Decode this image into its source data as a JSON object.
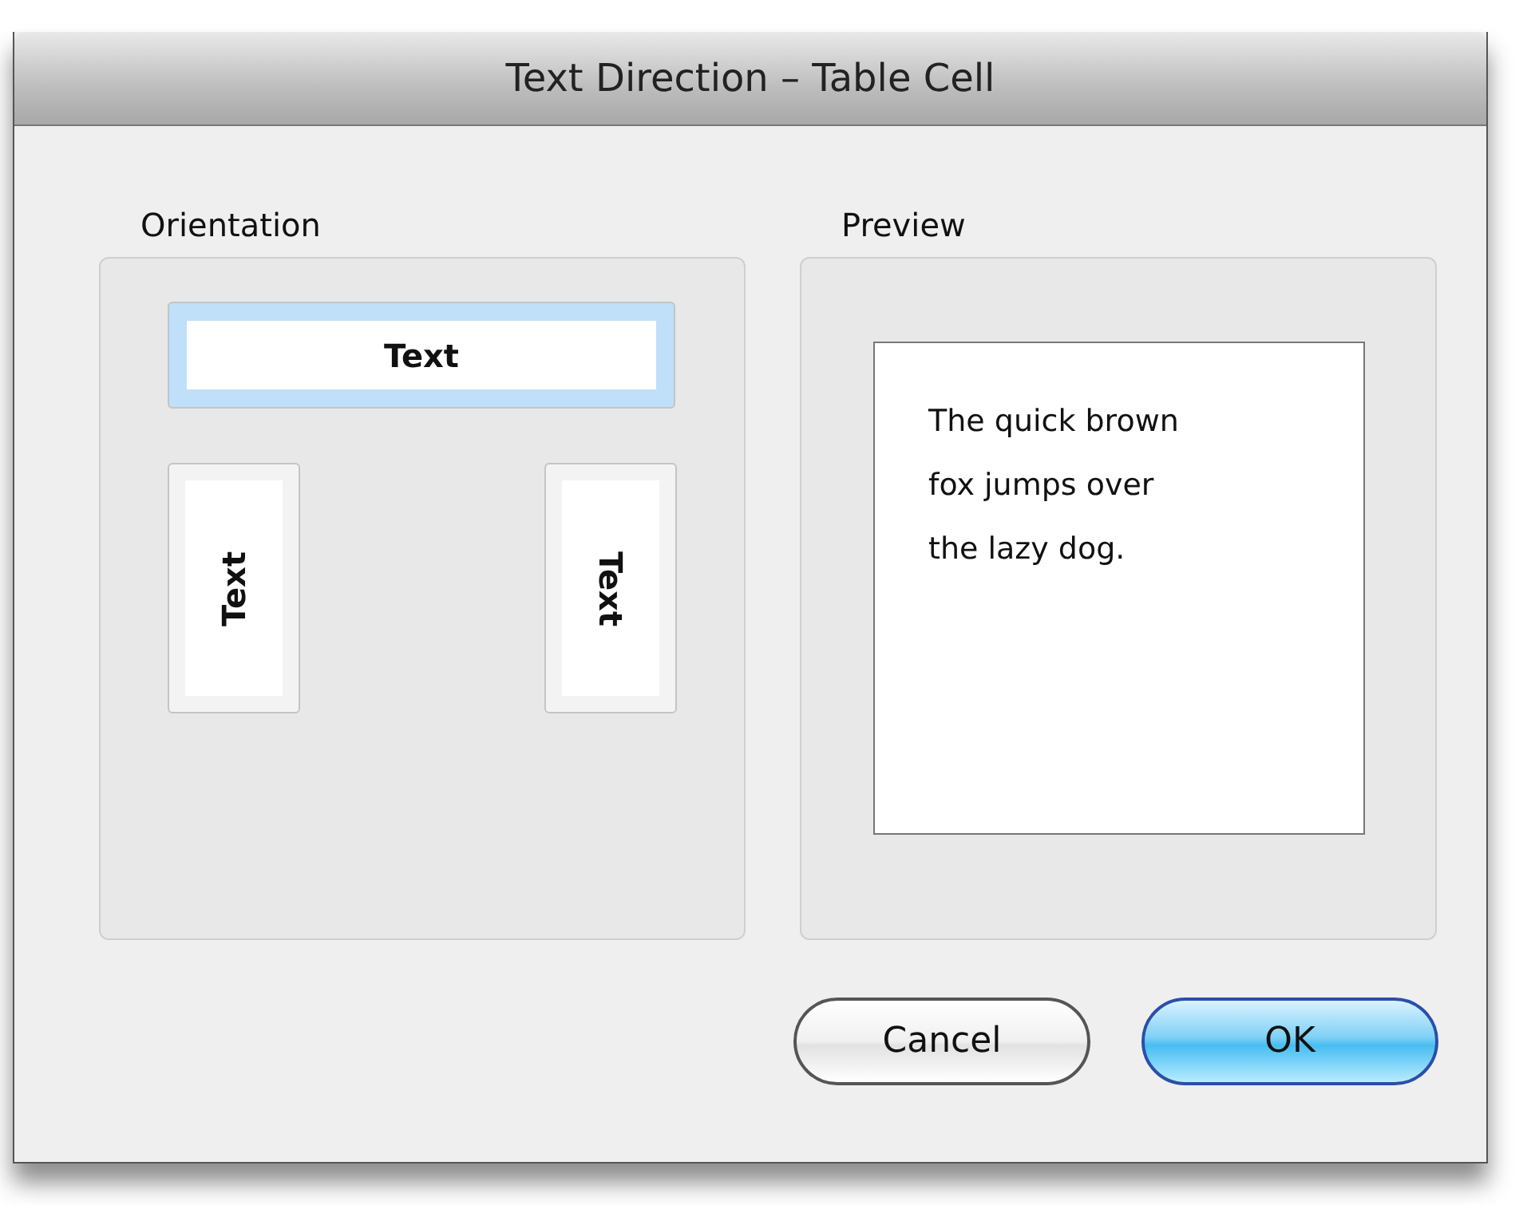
{
  "window": {
    "title": "Text Direction – Table Cell"
  },
  "orientation": {
    "label": "Orientation",
    "options": [
      {
        "kind": "horizontal",
        "label": "Text",
        "selected": true
      },
      {
        "kind": "up",
        "label": "Text",
        "selected": false
      },
      {
        "kind": "down",
        "label": "Text",
        "selected": false
      }
    ]
  },
  "preview": {
    "label": "Preview",
    "lines": [
      "The quick brown",
      "fox jumps over",
      "the lazy dog."
    ]
  },
  "buttons": [
    {
      "label": "Cancel",
      "default": false
    },
    {
      "label": "OK",
      "default": true
    }
  ]
}
